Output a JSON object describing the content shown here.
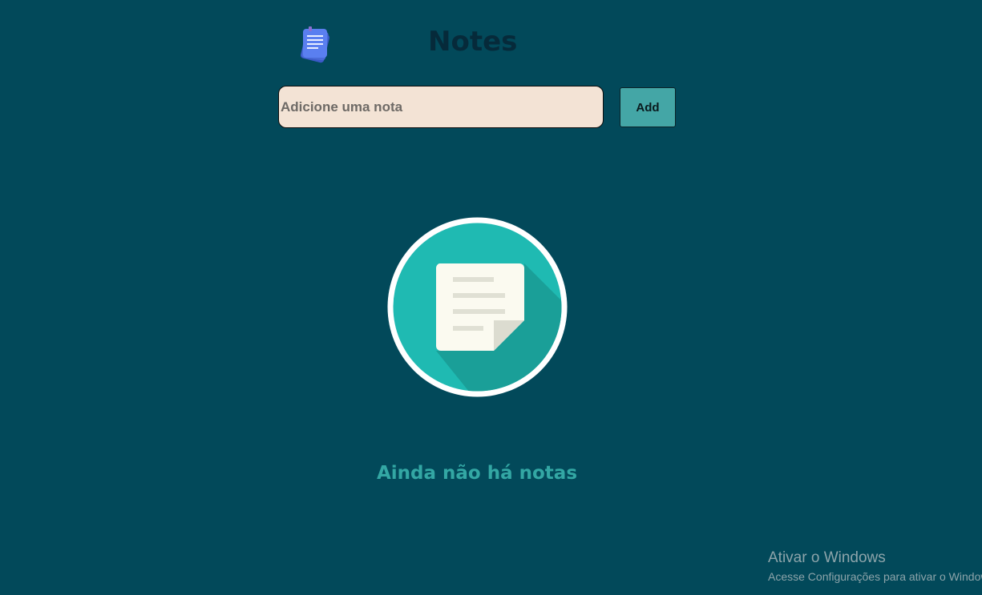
{
  "header": {
    "title": "Notes",
    "logo_icon": "notes-stack-icon"
  },
  "composer": {
    "input_value": "",
    "input_placeholder": "Adicione uma nota",
    "add_label": "Add"
  },
  "empty_state": {
    "icon": "empty-note-icon",
    "message": "Ainda não há notas"
  },
  "watermark": {
    "title": "Ativar o Windows",
    "subtitle": "Acesse Configurações para ativar o Windows."
  },
  "colors": {
    "background": "#02495a",
    "title": "#062a3a",
    "input_background": "#f3e3d5",
    "button_background": "#44a6a6",
    "circle_teal": "#1fbab2",
    "accent_text": "#33a7a4"
  }
}
